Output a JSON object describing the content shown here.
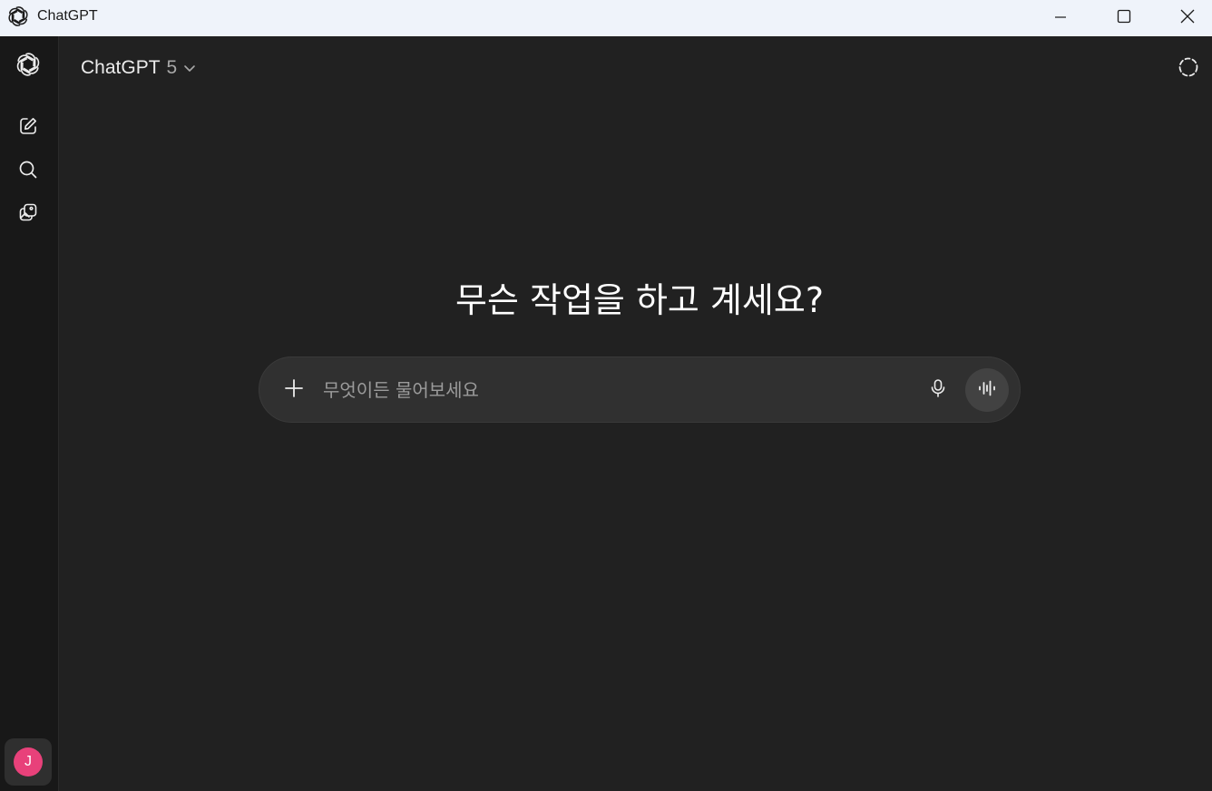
{
  "window": {
    "title": "ChatGPT",
    "app_icon": "openai-logo-icon",
    "controls": [
      "minimize-icon",
      "maximize-icon",
      "close-icon"
    ]
  },
  "sidebar": {
    "logo": "openai-logo-icon",
    "items": [
      {
        "icon": "new-chat-icon"
      },
      {
        "icon": "search-icon"
      },
      {
        "icon": "images-icon"
      }
    ],
    "avatar": {
      "initial": "J",
      "color": "#e8417a"
    }
  },
  "header": {
    "model_name": "ChatGPT",
    "model_version": "5",
    "temporary_chat_icon": "dashed-circle-icon"
  },
  "main": {
    "heading": "무슨 작업을 하고 계세요?",
    "composer": {
      "placeholder": "무엇이든 물어보세요",
      "value": ""
    }
  },
  "colors": {
    "background": "#212121",
    "sidebar": "#181818",
    "composer": "#303030",
    "titlebar": "#eff3fa",
    "avatar": "#e8417a"
  }
}
